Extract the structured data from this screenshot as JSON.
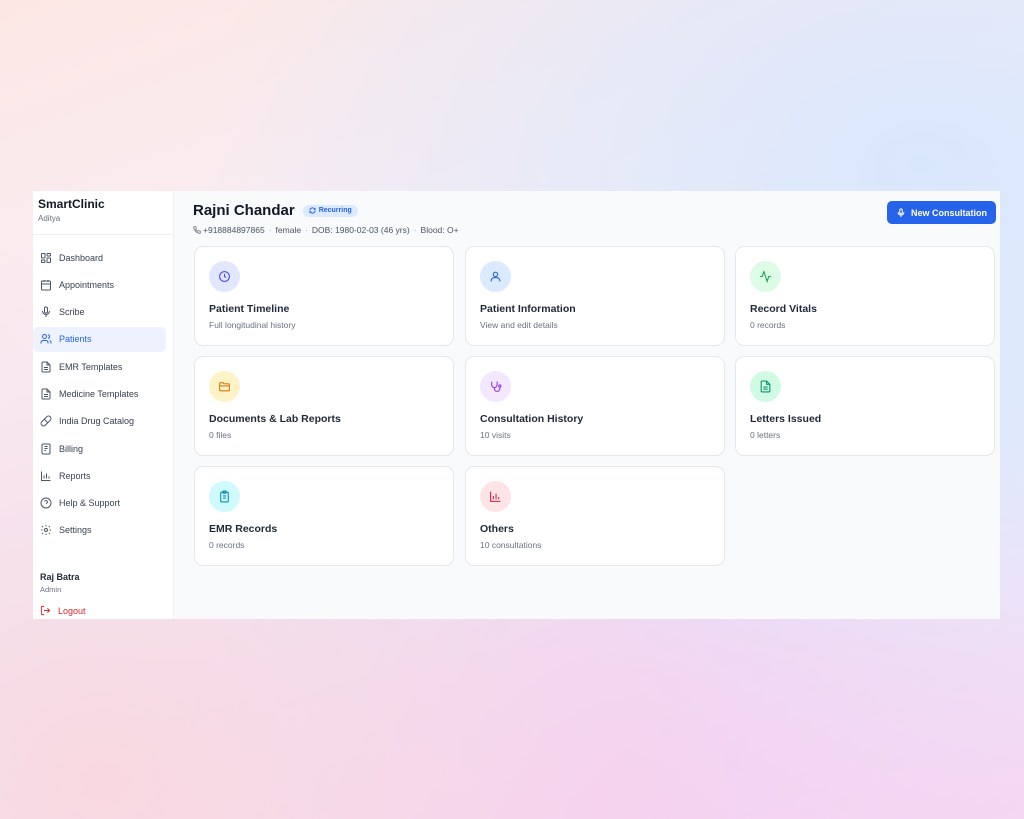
{
  "sidebar": {
    "brand": "SmartClinic",
    "sub": "Aditya",
    "items": [
      {
        "label": "Dashboard",
        "icon": "dashboard-icon"
      },
      {
        "label": "Appointments",
        "icon": "calendar-icon"
      },
      {
        "label": "Scribe",
        "icon": "microphone-icon"
      },
      {
        "label": "Patients",
        "icon": "users-icon",
        "active": true
      },
      {
        "label": "EMR Templates",
        "icon": "document-icon"
      },
      {
        "label": "Medicine Templates",
        "icon": "document-icon"
      },
      {
        "label": "India Drug Catalog",
        "icon": "pill-icon"
      },
      {
        "label": "Billing",
        "icon": "receipt-icon"
      },
      {
        "label": "Reports",
        "icon": "bar-chart-icon"
      },
      {
        "label": "Help & Support",
        "icon": "help-circle-icon"
      },
      {
        "label": "Settings",
        "icon": "gear-icon"
      }
    ],
    "user": {
      "name": "Raj Batra",
      "role": "Admin"
    },
    "logout": "Logout"
  },
  "patient": {
    "name": "Rajni Chandar",
    "badge": "Recurring",
    "phone": "+918884897865",
    "gender": "female",
    "dob": "DOB: 1980-02-03 (46 yrs)",
    "blood": "Blood: O+"
  },
  "actions": {
    "new_consultation": "New Consultation"
  },
  "cards": [
    {
      "title": "Patient Timeline",
      "subtitle": "Full longitudinal history",
      "icon": "clock-icon",
      "bg": "#e0e7ff",
      "fg": "#4f46e5"
    },
    {
      "title": "Patient Information",
      "subtitle": "View and edit details",
      "icon": "user-icon",
      "bg": "#dbeafe",
      "fg": "#2563eb"
    },
    {
      "title": "Record Vitals",
      "subtitle": "0 records",
      "icon": "activity-icon",
      "bg": "#dcfce7",
      "fg": "#16a34a"
    },
    {
      "title": "Documents & Lab Reports",
      "subtitle": "0 files",
      "icon": "folder-icon",
      "bg": "#fef3c7",
      "fg": "#d97706"
    },
    {
      "title": "Consultation History",
      "subtitle": "10 visits",
      "icon": "stethoscope-icon",
      "bg": "#f3e8ff",
      "fg": "#9333ea"
    },
    {
      "title": "Letters Issued",
      "subtitle": "0 letters",
      "icon": "file-text-icon",
      "bg": "#d1fae5",
      "fg": "#059669"
    },
    {
      "title": "EMR Records",
      "subtitle": "0 records",
      "icon": "clipboard-icon",
      "bg": "#cffafe",
      "fg": "#0891b2"
    },
    {
      "title": "Others",
      "subtitle": "10 consultations",
      "icon": "bar-chart-icon",
      "bg": "#ffe4e6",
      "fg": "#e11d48"
    }
  ]
}
